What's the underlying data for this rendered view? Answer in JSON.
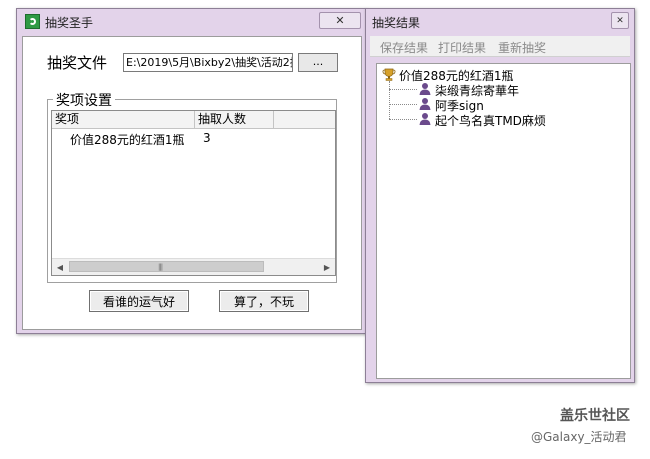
{
  "main_window": {
    "title": "抽奖圣手",
    "close_symbol": "✕",
    "file_label": "抽奖文件",
    "file_path": "E:\\2019\\5月\\Bixby2\\抽奖\\活动2抽",
    "browse_label": "...",
    "group_title": "奖项设置",
    "columns": [
      "奖项",
      "抽取人数"
    ],
    "rows": [
      {
        "prize": "价值288元的红酒1瓶",
        "count": "3"
      }
    ],
    "scroll_grip": "|||",
    "draw_button": "看谁的运气好",
    "quit_button": "算了，不玩"
  },
  "result_window": {
    "title": "抽奖结果",
    "close_symbol": "✕",
    "menu": [
      "保存结果",
      "打印结果",
      "重新抽奖"
    ],
    "tree_root": "价值288元的红酒1瓶",
    "winners": [
      "柒缎青综寄華年",
      "阿季sign",
      "起个鸟名真TMD麻烦"
    ]
  },
  "watermark": {
    "line1": "盖乐世社区",
    "line2": "@Galaxy_活动君"
  },
  "colors": {
    "window_frame": "#e3d3ea",
    "trophy": "#d7a12a",
    "user_icon": "#6b4a8c"
  }
}
